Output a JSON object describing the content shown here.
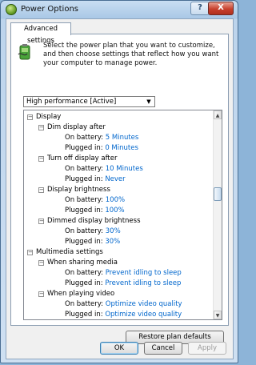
{
  "window": {
    "title": "Power Options",
    "help_label": "?",
    "close_label": "X"
  },
  "tab": {
    "label": "Advanced settings"
  },
  "intro_text": "Select the power plan that you want to customize, and then choose settings that reflect how you want your computer to manage power.",
  "plan_select": {
    "value": "High performance [Active]"
  },
  "tree": {
    "display": "Display",
    "dim_after": "Dim display after",
    "dim_battery_label": "On battery:",
    "dim_battery_value": "5 Minutes",
    "dim_plugged_label": "Plugged in:",
    "dim_plugged_value": "0 Minutes",
    "off_after": "Turn off display after",
    "off_battery_label": "On battery:",
    "off_battery_value": "10 Minutes",
    "off_plugged_label": "Plugged in:",
    "off_plugged_value": "Never",
    "brightness": "Display brightness",
    "bright_battery_label": "On battery:",
    "bright_battery_value": "100%",
    "bright_plugged_label": "Plugged in:",
    "bright_plugged_value": "100%",
    "dimmed_brightness": "Dimmed display brightness",
    "dimmed_battery_label": "On battery:",
    "dimmed_battery_value": "30%",
    "dimmed_plugged_label": "Plugged in:",
    "dimmed_plugged_value": "30%",
    "multimedia": "Multimedia settings",
    "sharing_media": "When sharing media",
    "share_battery_label": "On battery:",
    "share_battery_value": "Prevent idling to sleep",
    "share_plugged_label": "Plugged in:",
    "share_plugged_value": "Prevent idling to sleep",
    "playing_video": "When playing video",
    "video_battery_label": "On battery:",
    "video_battery_value": "Optimize video quality",
    "video_plugged_label": "Plugged in:",
    "video_plugged_value": "Optimize video quality",
    "collapse_glyph": "−"
  },
  "buttons": {
    "restore": "Restore plan defaults",
    "ok": "OK",
    "cancel": "Cancel",
    "apply": "Apply"
  },
  "colors": {
    "link_value": "#0066cc",
    "title_bar": "#a9c8e6"
  },
  "icons": {
    "app": "power-options-icon",
    "battery": "battery-plug-icon"
  }
}
